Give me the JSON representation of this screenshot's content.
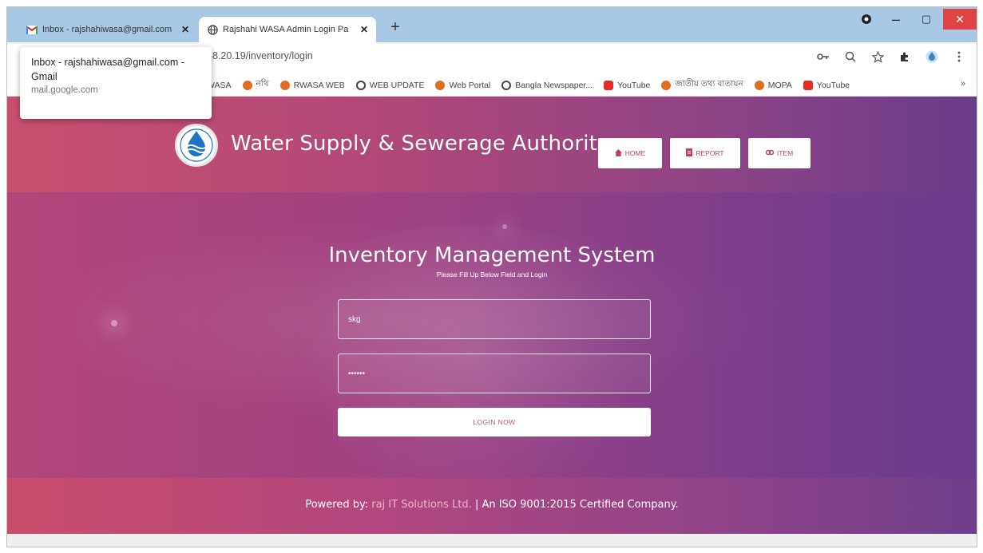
{
  "browser": {
    "tabs": [
      {
        "title": "Inbox - rajshahiwasa@gmail.com",
        "close": "✕",
        "icon": "gmail-icon"
      },
      {
        "title": "Rajshahi WASA Admin Login Pa",
        "close": "✕",
        "icon": "globe-icon"
      }
    ],
    "new_tab": "+",
    "window": {
      "minimize": "–",
      "maximize": "▢",
      "close": "✕"
    },
    "url": "58.20.19/inventory/login",
    "bookmarks": [
      {
        "label": "WASA",
        "color": "#ffffff"
      },
      {
        "label": "নথি",
        "color": "#e06d1f"
      },
      {
        "label": "RWASA WEB",
        "color": "#e06d1f"
      },
      {
        "label": "WEB UPDATE",
        "color": "#444444"
      },
      {
        "label": "Web Portal",
        "color": "#e06d1f"
      },
      {
        "label": "Bangla Newspaper...",
        "color": "#444444"
      },
      {
        "label": "YouTube",
        "color": "#e52d27"
      },
      {
        "label": "জাতীয় তথ্য বাতায়ন",
        "color": "#e06d1f"
      },
      {
        "label": "MOPA",
        "color": "#e06d1f"
      },
      {
        "label": "YouTube",
        "color": "#e52d27"
      }
    ],
    "bookmarks_more": "»",
    "tooltip": {
      "title": "Inbox - rajshahiwasa@gmail.com - Gmail",
      "domain": "mail.google.com"
    }
  },
  "site": {
    "brand": "Water Supply & Sewerage Authority",
    "nav": {
      "home": "HOME",
      "report": "REPORT",
      "item": "ITEM"
    },
    "form": {
      "title": "Inventory Management System",
      "subtitle": "Please Fill Up Below Field and Login",
      "username": "skg",
      "password": "••••••",
      "login": "LOGIN NOW"
    },
    "footer": {
      "powered": "Powered by:",
      "company": "raj IT Solutions Ltd.",
      "tail": "| An ISO 9001:2015 Certified Company."
    }
  },
  "colors": {
    "accent": "#c24a73",
    "accent_purple": "#6d3a8c",
    "chrome_tabstrip": "#a9c8e6"
  }
}
